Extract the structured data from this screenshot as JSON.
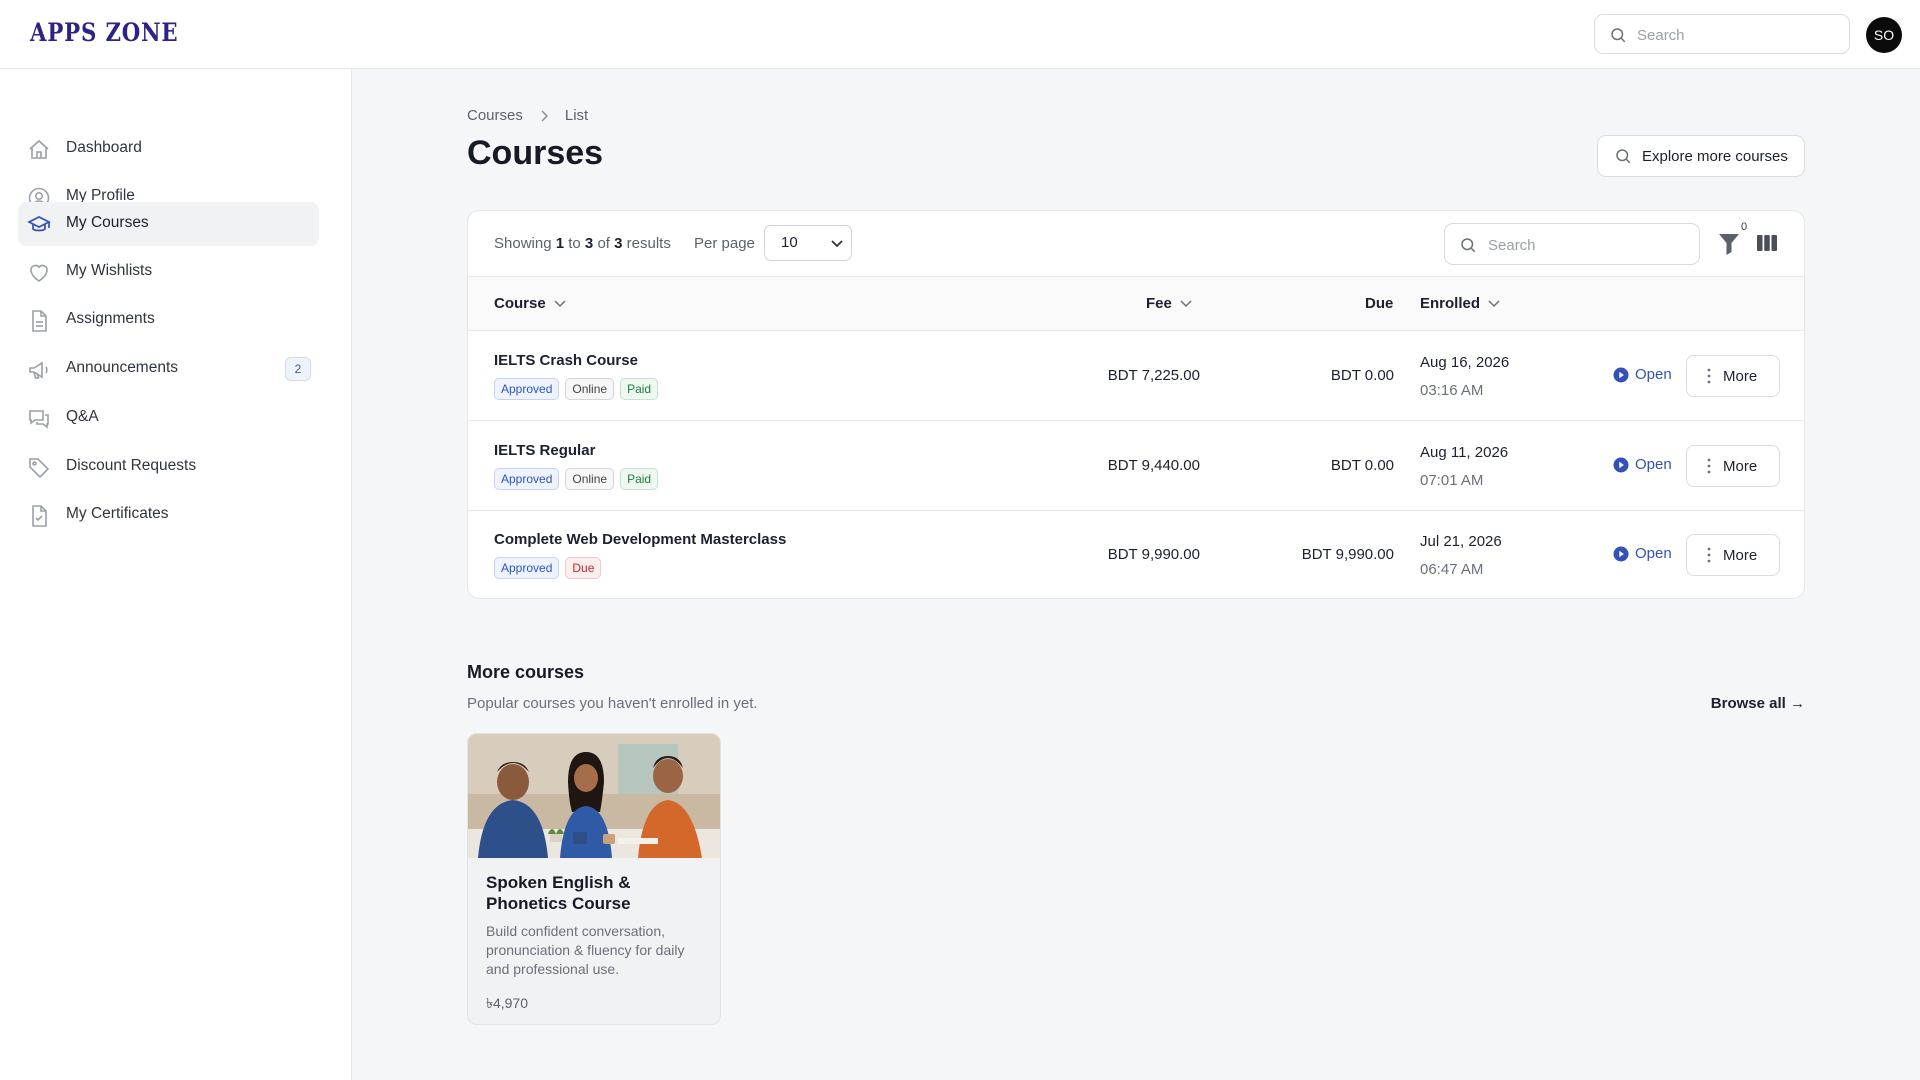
{
  "app": {
    "logo": "APPS ZONE",
    "avatar_initials": "SO"
  },
  "topbar": {
    "search_placeholder": "Search"
  },
  "sidebar": {
    "items": [
      {
        "label": "Dashboard",
        "icon": "home-icon"
      },
      {
        "label": "My Profile",
        "icon": "user-circle-icon"
      },
      {
        "label": "My Courses",
        "icon": "graduation-cap-icon",
        "active": true
      },
      {
        "label": "My Wishlists",
        "icon": "heart-icon"
      },
      {
        "label": "Assignments",
        "icon": "document-icon"
      },
      {
        "label": "Announcements",
        "icon": "megaphone-icon",
        "badge": "2"
      },
      {
        "label": "Q&A",
        "icon": "chat-bubbles-icon"
      },
      {
        "label": "Discount Requests",
        "icon": "tag-icon"
      },
      {
        "label": "My Certificates",
        "icon": "certificate-icon"
      }
    ]
  },
  "breadcrumb": {
    "root": "Courses",
    "current": "List"
  },
  "page": {
    "title": "Courses",
    "explore_label": "Explore more courses"
  },
  "table": {
    "showing": {
      "prefix": "Showing",
      "from": "1",
      "to_word": "to",
      "to": "3",
      "of_word": "of",
      "total": "3",
      "suffix": "results"
    },
    "per_page_label": "Per page",
    "per_page_value": "10",
    "search_placeholder": "Search",
    "filter_count": "0",
    "columns": {
      "course": "Course",
      "fee": "Fee",
      "due": "Due",
      "enrolled": "Enrolled"
    },
    "open_label": "Open",
    "more_label": "More",
    "rows": [
      {
        "name": "IELTS Crash Course",
        "tags": [
          "Approved",
          "Online",
          "Paid"
        ],
        "fee": "BDT 7,225.00",
        "due": "BDT 0.00",
        "date": "Aug 16, 2026",
        "time": "03:16 AM"
      },
      {
        "name": "IELTS Regular",
        "tags": [
          "Approved",
          "Online",
          "Paid"
        ],
        "fee": "BDT 9,440.00",
        "due": "BDT 0.00",
        "date": "Aug 11, 2026",
        "time": "07:01 AM"
      },
      {
        "name": "Complete Web Development Masterclass",
        "tags": [
          "Approved",
          "Due"
        ],
        "fee": "BDT 9,990.00",
        "due": "BDT 9,990.00",
        "date": "Jul 21, 2026",
        "time": "06:47 AM"
      }
    ]
  },
  "more_courses": {
    "title": "More courses",
    "subtitle": "Popular courses you haven't enrolled in yet.",
    "browse_all": "Browse all →",
    "card": {
      "title": "Spoken English & Phonetics Course",
      "description": "Build confident conversation, pronunciation & fluency for daily and professional use.",
      "price": "৳4,970"
    }
  },
  "colors": {
    "brand": "#2b2486",
    "accent": "#3451b8",
    "paid": "#1e7d3a",
    "due": "#c02828"
  }
}
